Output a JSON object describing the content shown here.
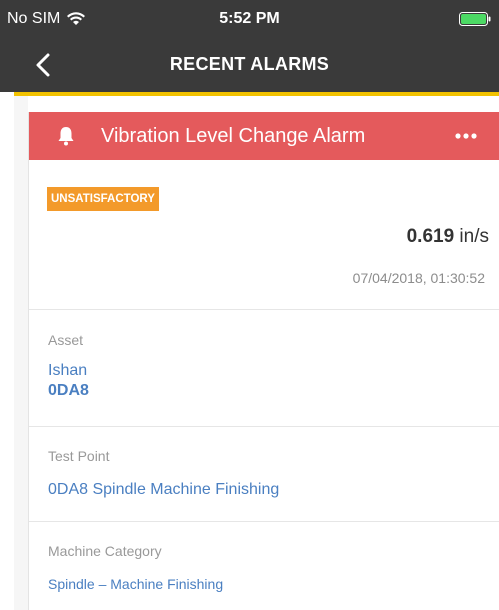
{
  "status_bar": {
    "carrier": "No SIM",
    "time": "5:52 PM",
    "icons": [
      "wifi-icon",
      "battery-icon"
    ]
  },
  "nav": {
    "title": "RECENT ALARMS",
    "back_icon": "back-chevron-icon"
  },
  "alarm": {
    "title": "Vibration Level Change Alarm",
    "header_color": "#e45a5c",
    "icons": [
      "bell-icon",
      "more-icon"
    ],
    "status_badge": "UNSATISFACTORY",
    "badge_color": "#f39a2a",
    "value": "0.619",
    "unit": "in/s",
    "timestamp": "07/04/2018, 01:30:52"
  },
  "details": {
    "asset_label": "Asset",
    "asset_name": "Ishan",
    "asset_id": "0DA8",
    "test_point_label": "Test Point",
    "test_point_value": "0DA8 Spindle Machine Finishing",
    "machine_category_label": "Machine Category",
    "machine_category_value": "Spindle – Machine Finishing"
  },
  "colors": {
    "nav_bg": "#3a3a3a",
    "nav_accent": "#f2c200",
    "link": "#4a7fc1"
  }
}
